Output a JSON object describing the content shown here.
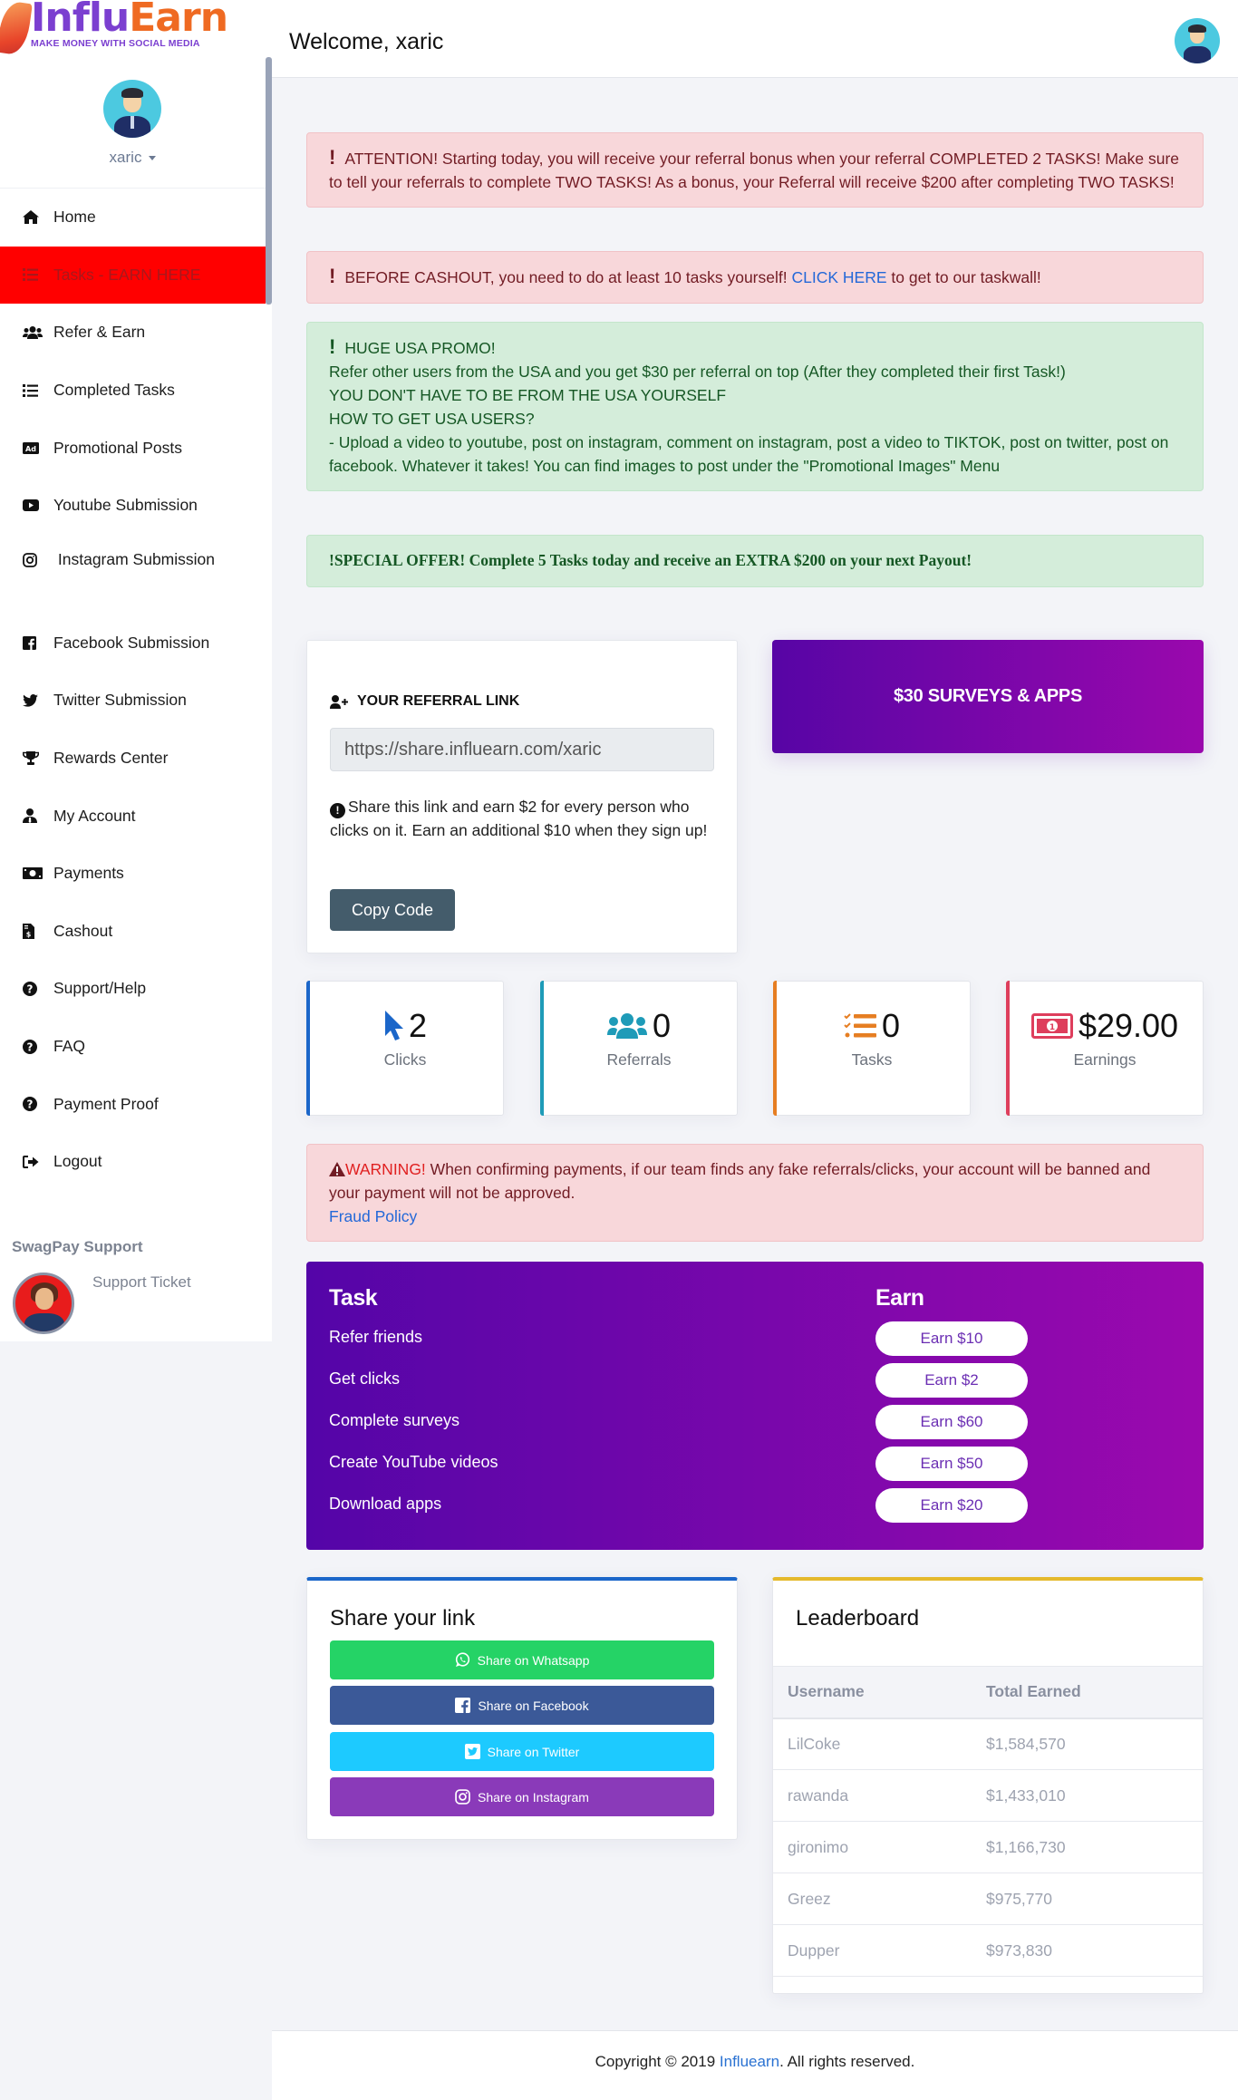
{
  "brand": {
    "name_part1": "Influ",
    "name_part2": "Earn",
    "tagline": "MAKE MONEY WITH SOCIAL MEDIA"
  },
  "user": {
    "username": "xaric"
  },
  "header": {
    "welcome": "Welcome, xaric"
  },
  "sidebar": {
    "items": [
      {
        "label": "Home",
        "icon": "home-icon"
      },
      {
        "label": "Tasks - EARN HERE",
        "icon": "tasks-icon",
        "active": true
      },
      {
        "label": "Refer & Earn",
        "icon": "users-icon"
      },
      {
        "label": "Completed Tasks",
        "icon": "tasks-icon"
      },
      {
        "label": "Promotional Posts",
        "icon": "ad-icon"
      },
      {
        "label": "Youtube Submission",
        "icon": "youtube-icon"
      },
      {
        "label": "Instagram Submission",
        "icon": "instagram-icon"
      },
      {
        "label": "Facebook Submission",
        "icon": "facebook-icon"
      },
      {
        "label": "Twitter Submission",
        "icon": "twitter-icon"
      },
      {
        "label": "Rewards Center",
        "icon": "trophy-icon"
      },
      {
        "label": "My Account",
        "icon": "user-tie-icon"
      },
      {
        "label": "Payments",
        "icon": "money-bill-icon"
      },
      {
        "label": "Cashout",
        "icon": "invoice-dollar-icon"
      },
      {
        "label": "Support/Help",
        "icon": "question-circle-icon"
      },
      {
        "label": "FAQ",
        "icon": "question-circle-icon"
      },
      {
        "label": "Payment Proof",
        "icon": "question-circle-icon"
      },
      {
        "label": "Logout",
        "icon": "sign-out-icon"
      }
    ],
    "support": {
      "title": "SwagPay Support",
      "link": "Support Ticket"
    }
  },
  "alerts": {
    "attention": "ATTENTION! Starting today, you will receive your referral bonus when your referral COMPLETED 2 TASKS! Make sure to tell your referrals to complete TWO TASKS! As a bonus, your Referral will receive $200 after completing TWO TASKS!",
    "cashout_before": "BEFORE CASHOUT, you need to do at least 10 tasks yourself!",
    "cashout_link": "CLICK HERE",
    "cashout_after": "to get to our taskwall!",
    "usa_lines": [
      "HUGE USA PROMO!",
      "Refer other users from the USA and you get $30 per referral on top (After they completed their first Task!)",
      "YOU DON'T HAVE TO BE FROM THE USA YOURSELF",
      "HOW TO GET USA USERS?",
      "- Upload a video to youtube, post on instagram, comment on instagram, post a video to TIKTOK, post on twitter, post on facebook. Whatever it takes! You can find images to post under the \"Promotional Images\" Menu"
    ],
    "special_offer": "SPECIAL OFFER! Complete 5 Tasks today and receive an EXTRA $200 on your next Payout!",
    "warning_label": "WARNING!",
    "warning_text": "When confirming payments, if our team finds any fake referrals/clicks, your account will be banned and your payment will not be approved.",
    "fraud_link": "Fraud Policy"
  },
  "referral": {
    "title": "YOUR REFERRAL LINK",
    "link_value": "https://share.influearn.com/xaric",
    "note": "Share this link and earn $2 for every person who clicks on it. Earn an additional $10 when they sign up!",
    "copy_button": "Copy Code"
  },
  "promo_button": "$30 SURVEYS & APPS",
  "stats": [
    {
      "value": "2",
      "label": "Clicks",
      "icon": "mouse-pointer-icon",
      "color": "#1b66c9"
    },
    {
      "value": "0",
      "label": "Referrals",
      "icon": "users-icon",
      "color": "#1e9bb8"
    },
    {
      "value": "0",
      "label": "Tasks",
      "icon": "tasks-icon",
      "color": "#e67e22"
    },
    {
      "value": "$29.00",
      "label": "Earnings",
      "icon": "money-bill-icon",
      "color": "#de3e5c"
    }
  ],
  "tasks": {
    "col_task": "Task",
    "col_earn": "Earn",
    "rows": [
      {
        "task": "Refer friends",
        "earn": "Earn $10"
      },
      {
        "task": "Get clicks",
        "earn": "Earn $2"
      },
      {
        "task": "Complete surveys",
        "earn": "Earn $60"
      },
      {
        "task": "Create YouTube videos",
        "earn": "Earn $50"
      },
      {
        "task": "Download apps",
        "earn": "Earn $20"
      }
    ]
  },
  "share": {
    "title": "Share your link",
    "buttons": [
      {
        "label": "Share on Whatsapp",
        "color": "#25d366",
        "icon": "whatsapp-icon"
      },
      {
        "label": "Share on Facebook",
        "color": "#3b5998",
        "icon": "facebook-icon"
      },
      {
        "label": "Share on Twitter",
        "color": "#1dcaff",
        "icon": "twitter-icon"
      },
      {
        "label": "Share on Instagram",
        "color": "#8a3ab9",
        "icon": "instagram-icon"
      }
    ]
  },
  "leaderboard": {
    "title": "Leaderboard",
    "columns": [
      "Username",
      "Total Earned"
    ],
    "rows": [
      [
        "LilCoke",
        "$1,584,570"
      ],
      [
        "rawanda",
        "$1,433,010"
      ],
      [
        "gironimo",
        "$1,166,730"
      ],
      [
        "Greez",
        "$975,770"
      ],
      [
        "Dupper",
        "$973,830"
      ]
    ]
  },
  "footer": {
    "before": "Copyright © 2019",
    "link": "Influearn",
    "after": ". All rights reserved."
  },
  "colors": {
    "active_nav": "#ff0000",
    "gradient_start": "#5405a8",
    "gradient_end": "#9b09ae"
  }
}
